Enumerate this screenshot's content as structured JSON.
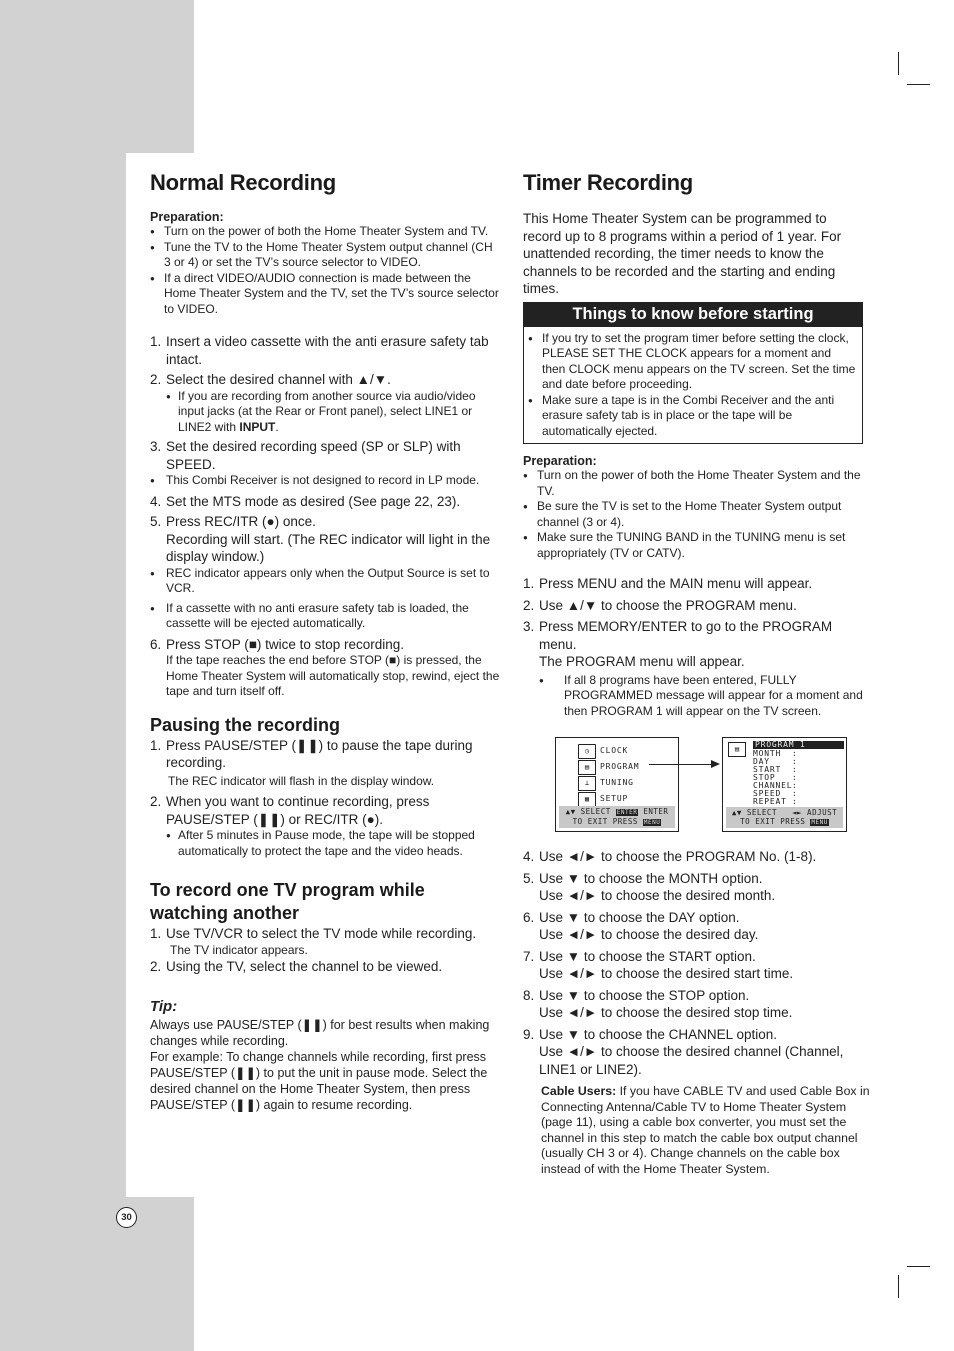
{
  "page_number": "30",
  "left": {
    "title": "Normal Recording",
    "preparation_label": "Preparation:",
    "preparation_items": [
      "Turn on the power of both the Home Theater System and TV.",
      "Tune the TV to the Home Theater System output channel (CH 3 or 4) or set the TV’s source selector to VIDEO.",
      "If a direct VIDEO/AUDIO connection is made between the Home Theater System and the TV, set the TV’s source selector to VIDEO."
    ],
    "steps": {
      "s1": {
        "num": "1.",
        "text": "Insert a video cassette with the anti erasure safety tab intact."
      },
      "s2": {
        "num": "2.",
        "text": "Select the desired channel with ▲/▼."
      },
      "s2_sub_pre": "If you are recording from another source via audio/video input jacks (at the Rear or Front panel), select LINE1 or LINE2 with ",
      "s2_sub_bold": "INPUT",
      "s2_sub_post": ".",
      "s3": {
        "num": "3.",
        "text": "Set the desired recording speed (SP or SLP) with SPEED."
      },
      "s3_bullet": "This Combi Receiver is not designed to record in LP mode.",
      "s4": {
        "num": "4.",
        "text": "Set the MTS mode as desired (See page 22, 23)."
      },
      "s5": {
        "num": "5.",
        "text": "Press REC/ITR (●) once."
      },
      "s5_note": "Recording will start. (The REC indicator will light in the display window.)",
      "s5_bullets": [
        "REC indicator appears only when the Output Source is set to VCR.",
        "If a cassette with no anti erasure safety tab is loaded, the cassette will be ejected automatically."
      ],
      "s6": {
        "num": "6.",
        "text": "Press STOP (■) twice to stop recording."
      },
      "s6_note": "If the tape reaches the end before STOP (■) is pressed, the Home Theater System will automatically stop, rewind, eject the tape and turn itself off."
    },
    "pausing": {
      "title": "Pausing the recording",
      "s1": {
        "num": "1.",
        "text": "Press PAUSE/STEP (❚❚) to pause the tape during recording."
      },
      "s1_note": "The REC indicator will flash in the display window.",
      "s2": {
        "num": "2.",
        "text": "When you want to continue recording, press PAUSE/STEP (❚❚) or REC/ITR (●)."
      },
      "s2_sub": "After 5 minutes in Pause mode, the tape will be stopped automatically to protect the tape and the video heads."
    },
    "watching": {
      "title": "To record one TV program while watching another",
      "s1": {
        "num": "1.",
        "text": "Use TV/VCR to select the TV mode while recording."
      },
      "s1_note": "The TV indicator appears.",
      "s2": {
        "num": "2.",
        "text": "Using the TV, select the channel to be viewed."
      }
    },
    "tip": {
      "title": "Tip:",
      "p1": "Always use PAUSE/STEP (❚❚) for best results when making changes while recording.",
      "p2": "For example: To change channels while recording, first press PAUSE/STEP (❚❚) to put the unit in pause mode. Select the desired channel on the Home Theater System, then press PAUSE/STEP (❚❚) again to resume recording."
    }
  },
  "right": {
    "title": "Timer Recording",
    "intro": "This Home Theater System can be programmed to record up to 8 programs within a period of 1 year. For unattended recording, the timer needs to know the channels to be recorded and the starting and ending times.",
    "box": {
      "title": "Things to know before starting",
      "items": [
        "If you try to set the program timer before setting the clock, PLEASE SET THE CLOCK appears for a moment and then CLOCK menu appears on the TV screen. Set the time and date before proceeding.",
        "Make sure a tape is in the Combi Receiver and the anti erasure safety tab is in place or the tape will be automatically ejected."
      ]
    },
    "preparation_label": "Preparation:",
    "preparation_items": [
      "Turn on the power of both the Home Theater System and the TV.",
      "Be sure the TV is set to the Home Theater System output channel (3 or 4).",
      "Make sure the TUNING BAND in the TUNING menu is set appropriately (TV or CATV)."
    ],
    "steps_a": [
      {
        "num": "1.",
        "text": "Press MENU and the MAIN menu will appear."
      },
      {
        "num": "2.",
        "text": "Use ▲/▼ to choose the PROGRAM menu."
      },
      {
        "num": "3.",
        "text": "Press MEMORY/ENTER to go to the PROGRAM menu."
      }
    ],
    "s3_note": "The PROGRAM menu will appear.",
    "s3_sub": "If all 8 programs have been entered, FULLY PROGRAMMED message will appear for a moment and then PROGRAM 1 will appear on the TV screen.",
    "main_menu": {
      "items": [
        "CLOCK",
        "PROGRAM",
        "TUNING",
        "SETUP"
      ],
      "icons": [
        "clock-icon",
        "program-icon",
        "tuning-icon",
        "setup-icon"
      ],
      "footer_line1_a": "▲▼ SELECT",
      "footer_enter_key": "ENTER",
      "footer_line1_b": "ENTER",
      "footer_line2": "TO EXIT PRESS",
      "footer_menu_key": "MENU"
    },
    "program_menu": {
      "header": "PROGRAM  1",
      "fields": [
        "MONTH",
        "DAY",
        "START",
        "STOP",
        "CHANNEL",
        "SPEED",
        "REPEAT"
      ],
      "separator": ":",
      "footer_line1_a": "▲▼ SELECT",
      "footer_line1_b": "◄► ADJUST",
      "footer_line2": "TO EXIT PRESS",
      "footer_menu_key": "MENU"
    },
    "steps_b": [
      {
        "num": "4.",
        "line1": "Use  ◄/► to choose the PROGRAM No. (1-8).",
        "line2": ""
      },
      {
        "num": "5.",
        "line1": "Use ▼ to choose the MONTH option.",
        "line2": "Use ◄/► to choose the desired month."
      },
      {
        "num": "6.",
        "line1": "Use ▼ to choose the DAY option.",
        "line2": "Use ◄/► to choose the desired day."
      },
      {
        "num": "7.",
        "line1": "Use ▼ to choose the START option.",
        "line2": "Use ◄/► to choose the desired start time."
      },
      {
        "num": "8.",
        "line1": "Use ▼ to choose the STOP option.",
        "line2": "Use ◄/► to choose the desired stop time."
      },
      {
        "num": "9.",
        "line1": "Use ▼ to choose the CHANNEL option.",
        "line2": "Use ◄/► to choose the desired channel (Channel, LINE1 or LINE2)."
      }
    ],
    "cable": {
      "label": "Cable Users:",
      "text": " If you have CABLE TV and used Cable Box in Connecting Antenna/Cable TV to Home Theater System (page 11), using a cable box converter, you must set the channel in this step to match the cable box output channel (usually CH 3 or 4). Change channels on the cable box instead of with the Home Theater System."
    }
  }
}
